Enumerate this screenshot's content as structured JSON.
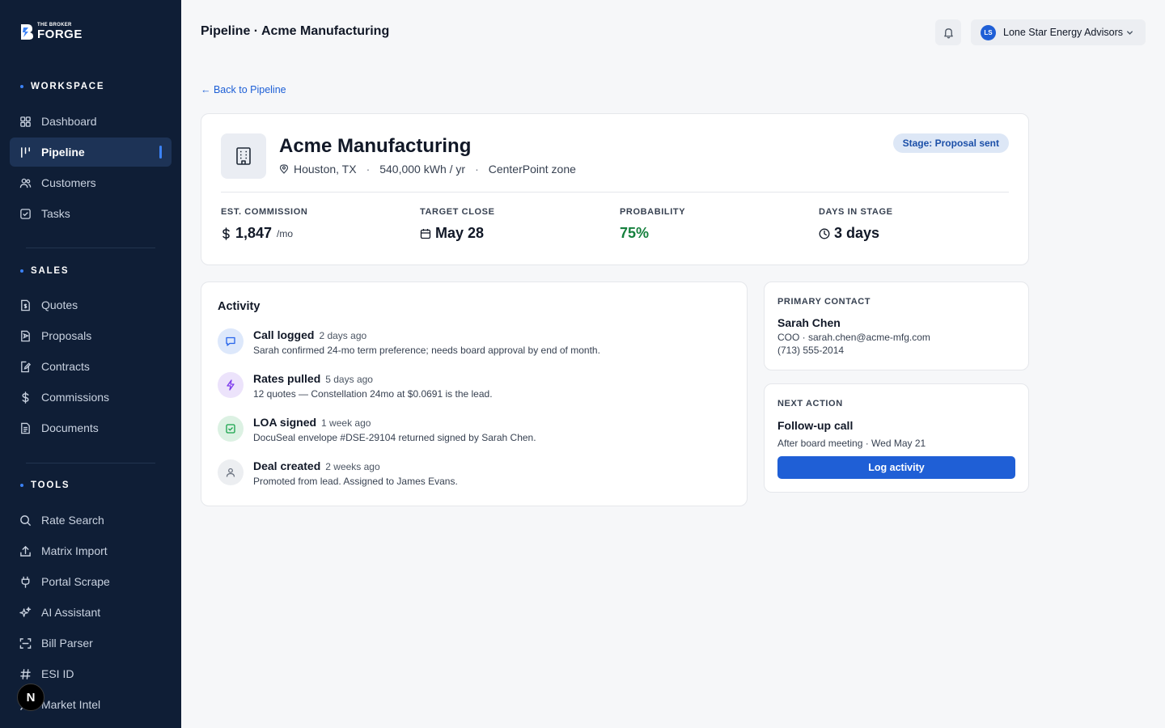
{
  "brand": {
    "top": "THE BROKER",
    "name": "FORGE"
  },
  "sidebar": {
    "workspace": {
      "heading": "WORKSPACE",
      "items": [
        {
          "label": "Dashboard",
          "icon": "dashboard-icon"
        },
        {
          "label": "Pipeline",
          "icon": "pipeline-icon",
          "active": true
        },
        {
          "label": "Customers",
          "icon": "users-icon"
        },
        {
          "label": "Tasks",
          "icon": "check-square-icon"
        }
      ]
    },
    "sales": {
      "heading": "SALES",
      "items": [
        {
          "label": "Quotes",
          "icon": "document-dollar-icon"
        },
        {
          "label": "Proposals",
          "icon": "document-send-icon"
        },
        {
          "label": "Contracts",
          "icon": "document-sign-icon"
        },
        {
          "label": "Commissions",
          "icon": "dollar-icon"
        },
        {
          "label": "Documents",
          "icon": "document-icon"
        }
      ]
    },
    "tools": {
      "heading": "TOOLS",
      "items": [
        {
          "label": "Rate Search",
          "icon": "search-icon"
        },
        {
          "label": "Matrix Import",
          "icon": "upload-icon"
        },
        {
          "label": "Portal Scrape",
          "icon": "plug-icon"
        },
        {
          "label": "AI Assistant",
          "icon": "sparkles-icon"
        },
        {
          "label": "Bill Parser",
          "icon": "scan-icon"
        },
        {
          "label": "ESI ID",
          "icon": "hash-icon"
        },
        {
          "label": "Market Intel",
          "icon": "chart-icon"
        }
      ]
    },
    "floating_badge": "N"
  },
  "header": {
    "title": "Pipeline · Acme Manufacturing",
    "account": {
      "initials": "LS",
      "name": "Lone Star Energy Advisors"
    }
  },
  "back_link": "← Back to Pipeline",
  "deal": {
    "name": "Acme Manufacturing",
    "location": "Houston, TX",
    "usage": "540,000 kWh / yr",
    "zone": "CenterPoint zone",
    "stage": "Stage: Proposal sent",
    "stats": {
      "commission": {
        "label": "EST. COMMISSION",
        "value": "1,847",
        "unit": "/mo"
      },
      "target_close": {
        "label": "TARGET CLOSE",
        "value": "May 28"
      },
      "probability": {
        "label": "PROBABILITY",
        "value": "75%"
      },
      "days_in_stage": {
        "label": "DAYS IN STAGE",
        "value": "3 days"
      }
    }
  },
  "activity": {
    "title": "Activity",
    "items": [
      {
        "title": "Call logged",
        "time": "2 days ago",
        "desc": "Sarah confirmed 24-mo term preference; needs board approval by end of month.",
        "icon": "chat-icon",
        "color": "#2563eb"
      },
      {
        "title": "Rates pulled",
        "time": "5 days ago",
        "desc": "12 quotes — Constellation 24mo at $0.0691 is the lead.",
        "icon": "bolt-icon",
        "color": "#7c3aed"
      },
      {
        "title": "LOA signed",
        "time": "1 week ago",
        "desc": "DocuSeal envelope #DSE-29104 returned signed by Sarah Chen.",
        "icon": "check-square-icon",
        "color": "#16a34a"
      },
      {
        "title": "Deal created",
        "time": "2 weeks ago",
        "desc": "Promoted from lead. Assigned to James Evans.",
        "icon": "user-icon",
        "color": "#6b7280"
      }
    ]
  },
  "contact": {
    "label": "PRIMARY CONTACT",
    "name": "Sarah Chen",
    "line1": "COO · sarah.chen@acme-mfg.com",
    "phone": "(713) 555-2014"
  },
  "next_action": {
    "label": "NEXT ACTION",
    "title": "Follow-up call",
    "detail": "After board meeting · Wed May 21",
    "button": "Log activity"
  },
  "colors": {
    "sidebar_bg": "#0f1e36",
    "accent": "#1f5fd6",
    "success": "#15803d"
  }
}
